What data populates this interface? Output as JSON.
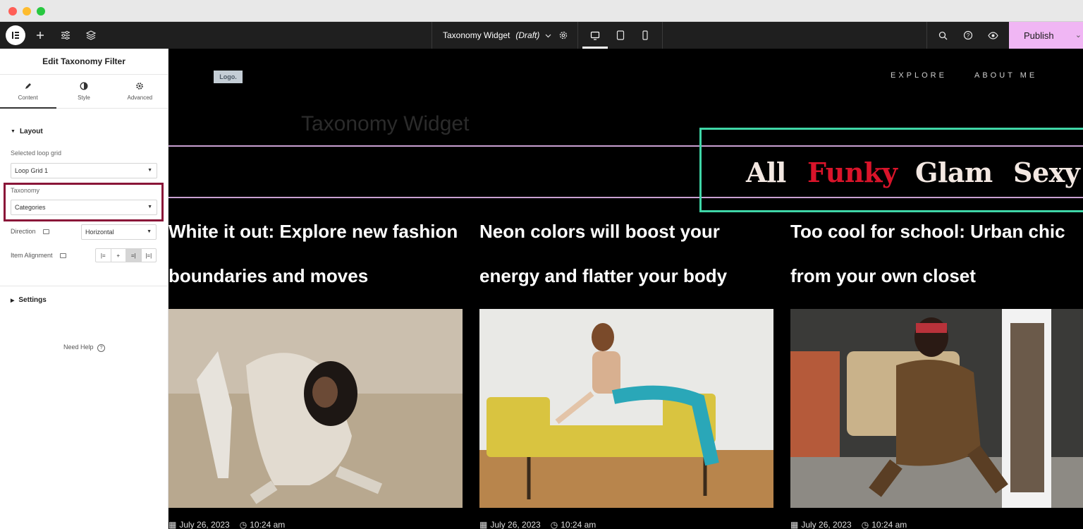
{
  "toolbar": {
    "doc_title": "Taxonomy Widget",
    "doc_status": "(Draft)",
    "publish_label": "Publish",
    "icons": [
      "elementor-logo-icon",
      "add-icon",
      "settings-sliders-icon",
      "layers-icon",
      "gear-icon",
      "desktop-icon",
      "tablet-icon",
      "mobile-icon",
      "search-icon",
      "help-icon",
      "preview-eye-icon",
      "chevron-down-icon"
    ]
  },
  "panel": {
    "title": "Edit Taxonomy Filter",
    "tabs": [
      {
        "label": "Content",
        "icon": "pencil-icon"
      },
      {
        "label": "Style",
        "icon": "half-circle-icon"
      },
      {
        "label": "Advanced",
        "icon": "gear-icon"
      }
    ],
    "layout_section": "Layout",
    "loop_grid_label": "Selected loop grid",
    "loop_grid_value": "Loop Grid 1",
    "taxonomy_label": "Taxonomy",
    "taxonomy_value": "Categories",
    "direction_label": "Direction",
    "direction_value": "Horizontal",
    "alignment_label": "Item Alignment",
    "settings_section": "Settings",
    "need_help": "Need Help"
  },
  "site": {
    "logo": "Logo.",
    "nav": [
      "EXPLORE",
      "ABOUT ME"
    ],
    "heading": "Taxonomy Widget",
    "taxonomy_items": [
      "All",
      "Funky",
      "Glam",
      "Sexy"
    ],
    "active_item": "Funky",
    "accent_color": "#3fd6a7",
    "active_color": "#d9142a"
  },
  "posts": [
    {
      "title_line1": "White it out: Explore new fashion",
      "title_line2": "boundaries and moves",
      "date": "July 26, 2023",
      "time": "10:24 am"
    },
    {
      "title_line1": "Neon colors will boost your",
      "title_line2": "energy and flatter your body",
      "date": "July 26, 2023",
      "time": "10:24 am"
    },
    {
      "title_line1": "Too cool for school: Urban chic",
      "title_line2": "from your own closet",
      "date": "July 26, 2023",
      "time": "10:24 am"
    }
  ]
}
